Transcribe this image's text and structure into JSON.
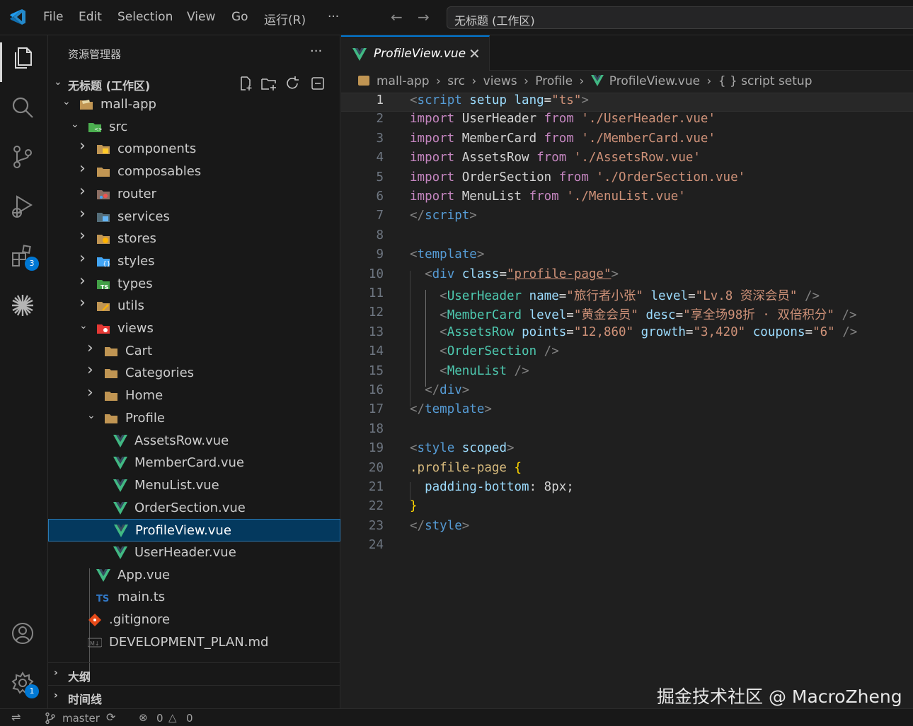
{
  "titlebar": {
    "menus": [
      "File",
      "Edit",
      "Selection",
      "View",
      "Go",
      "运行(R)",
      "···"
    ],
    "command_center": "无标题 (工作区)"
  },
  "activitybar": {
    "extensions_badge": "3",
    "settings_badge": "1"
  },
  "sidebar": {
    "title": "资源管理器",
    "more": "···",
    "workspace": "无标题 (工作区)",
    "tree": [
      {
        "label": "mall-app",
        "depth": 0,
        "expanded": true,
        "icon": "project-folder"
      },
      {
        "label": "src",
        "depth": 1,
        "expanded": true,
        "icon": "src-folder"
      },
      {
        "label": "components",
        "depth": 2,
        "expanded": false,
        "icon": "components-folder"
      },
      {
        "label": "composables",
        "depth": 2,
        "expanded": false,
        "icon": "folder"
      },
      {
        "label": "router",
        "depth": 2,
        "expanded": false,
        "icon": "router-folder"
      },
      {
        "label": "services",
        "depth": 2,
        "expanded": false,
        "icon": "services-folder"
      },
      {
        "label": "stores",
        "depth": 2,
        "expanded": false,
        "icon": "stores-folder"
      },
      {
        "label": "styles",
        "depth": 2,
        "expanded": false,
        "icon": "styles-folder"
      },
      {
        "label": "types",
        "depth": 2,
        "expanded": false,
        "icon": "types-folder"
      },
      {
        "label": "utils",
        "depth": 2,
        "expanded": false,
        "icon": "utils-folder"
      },
      {
        "label": "views",
        "depth": 2,
        "expanded": true,
        "icon": "views-folder"
      },
      {
        "label": "Cart",
        "depth": 3,
        "expanded": false,
        "icon": "folder"
      },
      {
        "label": "Categories",
        "depth": 3,
        "expanded": false,
        "icon": "folder"
      },
      {
        "label": "Home",
        "depth": 3,
        "expanded": false,
        "icon": "folder"
      },
      {
        "label": "Profile",
        "depth": 3,
        "expanded": true,
        "icon": "folder"
      },
      {
        "label": "AssetsRow.vue",
        "depth": 4,
        "icon": "vue"
      },
      {
        "label": "MemberCard.vue",
        "depth": 4,
        "icon": "vue"
      },
      {
        "label": "MenuList.vue",
        "depth": 4,
        "icon": "vue"
      },
      {
        "label": "OrderSection.vue",
        "depth": 4,
        "icon": "vue"
      },
      {
        "label": "ProfileView.vue",
        "depth": 4,
        "icon": "vue",
        "selected": true
      },
      {
        "label": "UserHeader.vue",
        "depth": 4,
        "icon": "vue"
      },
      {
        "label": "App.vue",
        "depth": 2,
        "icon": "vue"
      },
      {
        "label": "main.ts",
        "depth": 2,
        "icon": "ts"
      },
      {
        "label": ".gitignore",
        "depth": 1,
        "icon": "git"
      },
      {
        "label": "DEVELOPMENT_PLAN.md",
        "depth": 1,
        "icon": "markdown"
      }
    ],
    "outline": "大纲",
    "timeline": "时间线"
  },
  "editor": {
    "tab": "ProfileView.vue",
    "breadcrumbs": [
      "mall-app",
      "src",
      "views",
      "Profile",
      "ProfileView.vue",
      "{ } script setup"
    ],
    "lines": [
      [
        [
          "p",
          "<"
        ],
        [
          "t",
          "script"
        ],
        [
          "a",
          " setup"
        ],
        [
          "a",
          " lang"
        ],
        [
          "d",
          "="
        ],
        [
          "s",
          "\"ts\""
        ],
        [
          "p",
          ">"
        ]
      ],
      [
        [
          "kw",
          "import"
        ],
        [
          "d",
          " UserHeader "
        ],
        [
          "kw",
          "from"
        ],
        [
          "s",
          " './UserHeader.vue'"
        ]
      ],
      [
        [
          "kw",
          "import"
        ],
        [
          "d",
          " MemberCard "
        ],
        [
          "kw",
          "from"
        ],
        [
          "s",
          " './MemberCard.vue'"
        ]
      ],
      [
        [
          "kw",
          "import"
        ],
        [
          "d",
          " AssetsRow "
        ],
        [
          "kw",
          "from"
        ],
        [
          "s",
          " './AssetsRow.vue'"
        ]
      ],
      [
        [
          "kw",
          "import"
        ],
        [
          "d",
          " OrderSection "
        ],
        [
          "kw",
          "from"
        ],
        [
          "s",
          " './OrderSection.vue'"
        ]
      ],
      [
        [
          "kw",
          "import"
        ],
        [
          "d",
          " MenuList "
        ],
        [
          "kw",
          "from"
        ],
        [
          "s",
          " './MenuList.vue'"
        ]
      ],
      [
        [
          "p",
          "</"
        ],
        [
          "t",
          "script"
        ],
        [
          "p",
          ">"
        ]
      ],
      [],
      [
        [
          "p",
          "<"
        ],
        [
          "t",
          "template"
        ],
        [
          "p",
          ">"
        ]
      ],
      [
        [
          "d",
          "  "
        ],
        [
          "p",
          "<"
        ],
        [
          "t",
          "div"
        ],
        [
          "a",
          " class"
        ],
        [
          "d",
          "="
        ],
        [
          "s",
          "\"profile-page\""
        ],
        [
          "p",
          ">"
        ]
      ],
      [
        [
          "d",
          "    "
        ],
        [
          "p",
          "<"
        ],
        [
          "c",
          "UserHeader"
        ],
        [
          "a",
          " name"
        ],
        [
          "d",
          "="
        ],
        [
          "s",
          "\"旅行者小张\""
        ],
        [
          "a",
          " level"
        ],
        [
          "d",
          "="
        ],
        [
          "s",
          "\"Lv.8 资深会员\""
        ],
        [
          "p",
          " />"
        ]
      ],
      [
        [
          "d",
          "    "
        ],
        [
          "p",
          "<"
        ],
        [
          "c",
          "MemberCard"
        ],
        [
          "a",
          " level"
        ],
        [
          "d",
          "="
        ],
        [
          "s",
          "\"黄金会员\""
        ],
        [
          "a",
          " desc"
        ],
        [
          "d",
          "="
        ],
        [
          "s",
          "\"享全场98折 · 双倍积分\""
        ],
        [
          "p",
          " />"
        ]
      ],
      [
        [
          "d",
          "    "
        ],
        [
          "p",
          "<"
        ],
        [
          "c",
          "AssetsRow"
        ],
        [
          "a",
          " points"
        ],
        [
          "d",
          "="
        ],
        [
          "s",
          "\"12,860\""
        ],
        [
          "a",
          " growth"
        ],
        [
          "d",
          "="
        ],
        [
          "s",
          "\"3,420\""
        ],
        [
          "a",
          " coupons"
        ],
        [
          "d",
          "="
        ],
        [
          "s",
          "\"6\""
        ],
        [
          "p",
          " />"
        ]
      ],
      [
        [
          "d",
          "    "
        ],
        [
          "p",
          "<"
        ],
        [
          "c",
          "OrderSection"
        ],
        [
          "p",
          " />"
        ]
      ],
      [
        [
          "d",
          "    "
        ],
        [
          "p",
          "<"
        ],
        [
          "c",
          "MenuList"
        ],
        [
          "p",
          " />"
        ]
      ],
      [
        [
          "d",
          "  "
        ],
        [
          "p",
          "</"
        ],
        [
          "t",
          "div"
        ],
        [
          "p",
          ">"
        ]
      ],
      [
        [
          "p",
          "</"
        ],
        [
          "t",
          "template"
        ],
        [
          "p",
          ">"
        ]
      ],
      [],
      [
        [
          "p",
          "<"
        ],
        [
          "t",
          "style"
        ],
        [
          "a",
          " scoped"
        ],
        [
          "p",
          ">"
        ]
      ],
      [
        [
          "sel",
          ".profile-page"
        ],
        [
          "y",
          " {"
        ]
      ],
      [
        [
          "d",
          "  "
        ],
        [
          "a",
          "padding-bottom"
        ],
        [
          "d",
          ": 8px;"
        ]
      ],
      [
        [
          "y",
          "}"
        ]
      ],
      [
        [
          "p",
          "</"
        ],
        [
          "t",
          "style"
        ],
        [
          "p",
          ">"
        ]
      ],
      []
    ]
  },
  "statusbar": {
    "branch": "master",
    "errors": "0",
    "warnings": "0"
  },
  "watermark": "掘金技术社区 @ MacroZheng"
}
